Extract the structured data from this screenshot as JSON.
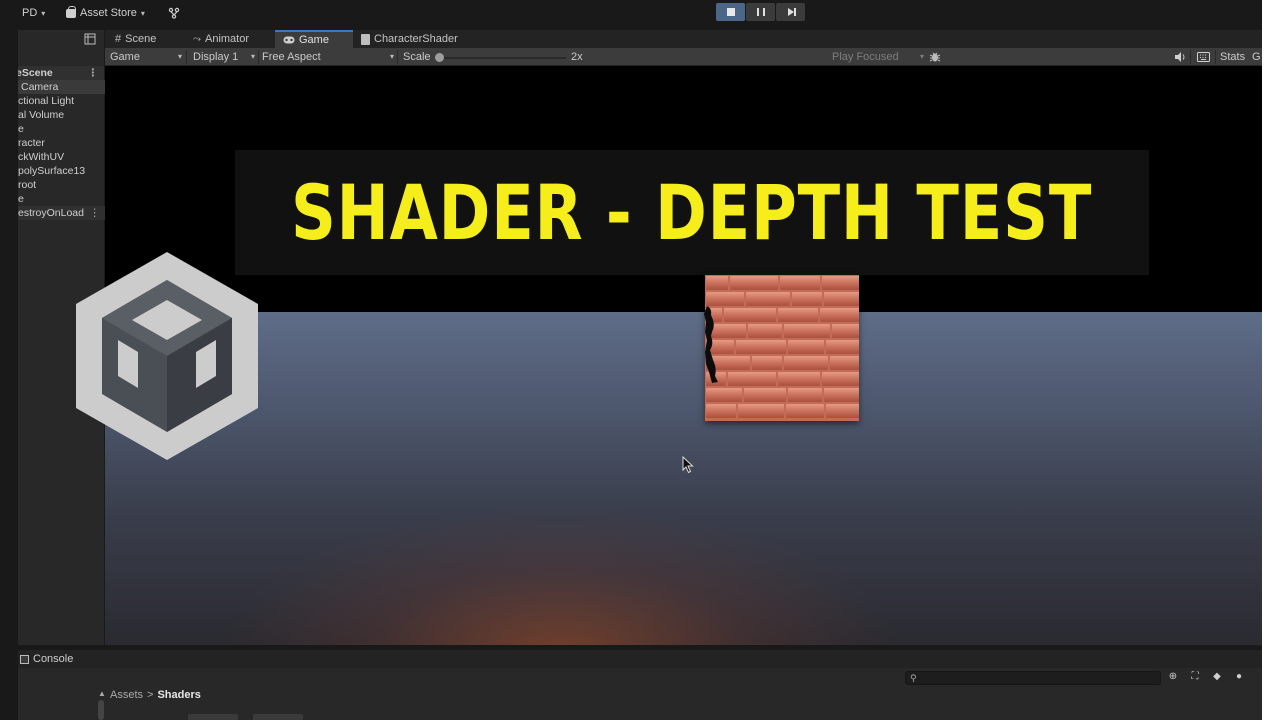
{
  "topbar": {
    "account_label": "PD",
    "asset_store_label": "Asset Store",
    "caret": "▾"
  },
  "hierarchy": {
    "scene_name": "eScene",
    "items": [
      "Camera",
      "ctional Light",
      "al Volume",
      "e",
      "racter",
      "ckWithUV",
      "polySurface13",
      "root",
      "e",
      "estroyOnLoad"
    ]
  },
  "tabs": {
    "scene": "Scene",
    "animator": "Animator",
    "game": "Game",
    "character_shader": "CharacterShader"
  },
  "game_toolbar": {
    "mode": "Game",
    "display": "Display 1",
    "aspect": "Free Aspect",
    "scale_label": "Scale",
    "scale_value": "2x",
    "play_focused": "Play Focused",
    "stats": "Stats",
    "gizmos_initial": "G"
  },
  "viewport": {
    "title": "SHADER - DEPTH TEST"
  },
  "console": {
    "tab_label": "Console"
  },
  "project": {
    "breadcrumb_root": "Assets",
    "breadcrumb_sep": ">",
    "breadcrumb_current": "Shaders"
  },
  "icons": [
    "bag-icon",
    "hierarchy-lock-icon",
    "grid-icon",
    "animator-icon",
    "gamepad-icon",
    "shader-icon",
    "bug-icon",
    "audio-icon",
    "keyboard-icon",
    "search-icon",
    "unity-logo-icon"
  ]
}
